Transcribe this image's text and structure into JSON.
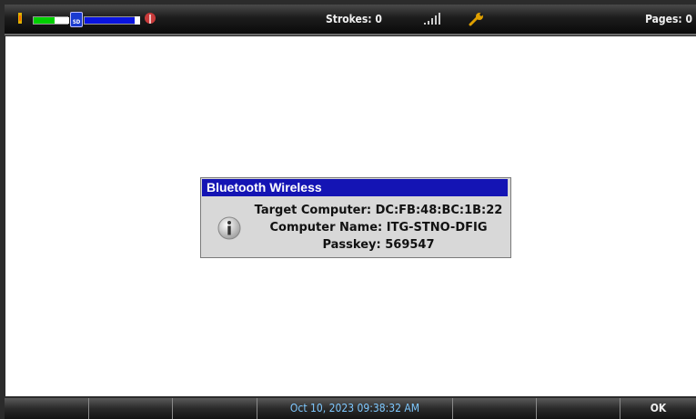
{
  "status_bar": {
    "strokes_label": "Strokes: 0",
    "pages_label": "Pages: 0",
    "sd_label": "SD",
    "battery_level_percent": 70,
    "storage_level_percent": 90,
    "icons": [
      "battery-icon",
      "sd-card-icon",
      "pen-icon",
      "signal-icon",
      "wrench-icon"
    ]
  },
  "dialog": {
    "title": "Bluetooth Wireless",
    "lines": [
      "Target Computer: DC:FB:48:BC:1B:22",
      "Computer Name: ITG-STNO-DFIG",
      "Passkey: 569547"
    ],
    "icon": "info-icon"
  },
  "bottom_bar": {
    "date_time": "Oct 10, 2023  09:38:32 AM",
    "ok_label": "OK"
  },
  "colors": {
    "title_bar": "#1414b4",
    "date_text": "#7ec8ff",
    "battery": "#00d000",
    "storage": "#0a14e0"
  }
}
